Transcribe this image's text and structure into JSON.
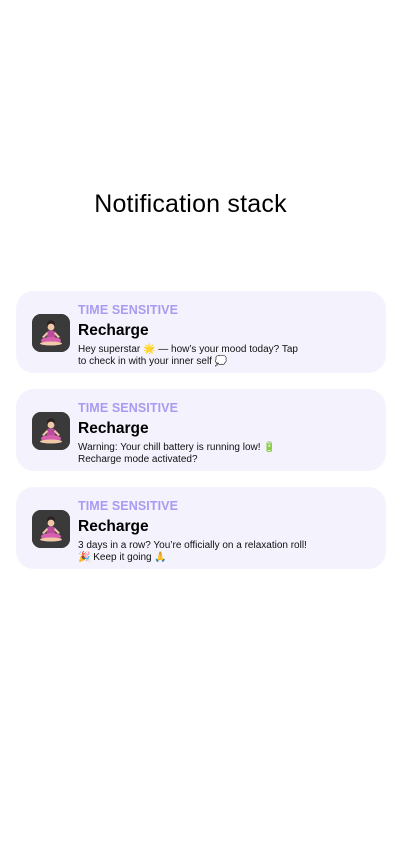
{
  "page": {
    "title": "Notification stack"
  },
  "notifications": [
    {
      "label": "TIME SENSITIVE",
      "title": "Recharge",
      "body": "Hey superstar 🌟 — how’s your mood today? Tap to check in with your inner self 💭",
      "icon": "meditation-icon"
    },
    {
      "label": "TIME SENSITIVE",
      "title": "Recharge",
      "body": "Warning: Your chill battery is running low! 🔋 Recharge mode activated?",
      "icon": "meditation-icon"
    },
    {
      "label": "TIME SENSITIVE",
      "title": "Recharge",
      "body": "3 days in a row? You’re officially on a relaxation roll! 🎉 Keep it going 🙏",
      "icon": "meditation-icon"
    }
  ],
  "colors": {
    "card_bg": "#f4f2fd",
    "label": "#a79bf2",
    "icon_bg": "#3a3a3a"
  }
}
